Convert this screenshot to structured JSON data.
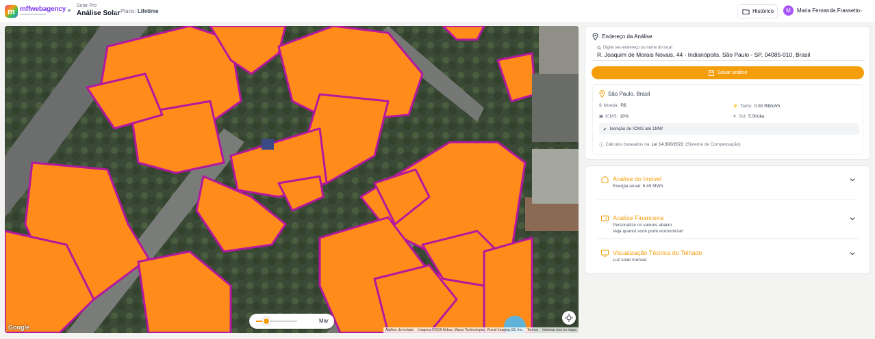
{
  "header": {
    "brand": "mffwebagency",
    "app_kicker": "Solar Pro",
    "app_title": "Análise Solar",
    "plan_label": "Plano:",
    "plan_value": "Lifetime",
    "history_label": "Histórico",
    "user_initial": "M",
    "user_name": "Maria Fernanda Frassetto"
  },
  "map": {
    "slider_label": "Mar",
    "slider_value": 0.25,
    "google": "Google",
    "attribution": [
      "Atalhos do teclado",
      "Imagens ©2026 Airbus, Maxar Technologies, Vexcel Imaging US, Inc.",
      "Termos",
      "Informar erro no mapa"
    ]
  },
  "address": {
    "header": "Endereço da Análise.",
    "placeholder": "Digite seu endereço ou nome do local",
    "value": "R. Joaquim de Morais Novais, 44 - Indianópolis, São Paulo - SP, 04085-010, Brasil",
    "save_label": "Salvar análise",
    "location": "São Paulo, Brasil",
    "currency_label": "Moeda:",
    "currency_value": "R$",
    "tariff_label": "Tarifa:",
    "tariff_value": "0.92 R$/kWh",
    "icms_label": "ICMS:",
    "icms_value": "18%",
    "sun_label": "Sol:",
    "sun_value": "5.0h/dia",
    "exemption": "Isenção de ICMS até 1MW",
    "calc_prefix": "Cálculos baseados na",
    "calc_law": "Lei 14.300/2022",
    "calc_suffix": "(Sistema de Compensação)"
  },
  "accordion": [
    {
      "title": "Análise do Imóvel",
      "sub1": "Energia anual: 6.49 MWh",
      "sub2": ""
    },
    {
      "title": "Análise Financeira",
      "sub1": "Personalize os valores abaixo",
      "sub2": "Veja quanto você pode economizar!"
    },
    {
      "title": "Visualização Técnica do Telhado",
      "sub1": "Luz solar mensal",
      "sub2": ""
    }
  ],
  "colors": {
    "accent": "#f59e0b",
    "roof": "#ff8c1a",
    "roof_edge": "#b5179e"
  }
}
